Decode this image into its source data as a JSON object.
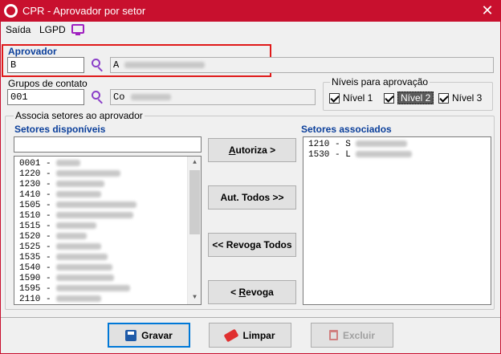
{
  "window": {
    "title": "CPR - Aprovador por setor",
    "close_glyph": "✕"
  },
  "menu": {
    "items": [
      "Saída",
      "LGPD"
    ]
  },
  "aprovador": {
    "label": "Aprovador",
    "code": "B",
    "name": "A"
  },
  "grupos": {
    "label": "Grupos de contato",
    "code": "001",
    "name": "Co"
  },
  "niveis": {
    "legend": "Níveis para aprovação",
    "items": [
      {
        "label": "Nível 1",
        "checked": true
      },
      {
        "label": "Nível 2",
        "checked": true
      },
      {
        "label": "Nível 3",
        "checked": true
      }
    ]
  },
  "associa": {
    "legend": "Associa setores ao aprovador"
  },
  "disponiveis": {
    "label": "Setores disponíveis",
    "filter_value": "",
    "rows": [
      {
        "code": "0001 -",
        "blur_w": 30
      },
      {
        "code": "1220 -",
        "blur_w": 80
      },
      {
        "code": "1230 -",
        "blur_w": 60
      },
      {
        "code": "1410 -",
        "blur_w": 56
      },
      {
        "code": "1505 -",
        "blur_w": 100
      },
      {
        "code": "1510 -",
        "blur_w": 96
      },
      {
        "code": "1515 -",
        "blur_w": 50
      },
      {
        "code": "1520 -",
        "blur_w": 38
      },
      {
        "code": "1525 -",
        "blur_w": 56
      },
      {
        "code": "1535 -",
        "blur_w": 64
      },
      {
        "code": "1540 -",
        "blur_w": 70
      },
      {
        "code": "1590 -",
        "blur_w": 72
      },
      {
        "code": "1595 -",
        "blur_w": 92
      },
      {
        "code": "2110 -",
        "blur_w": 56
      }
    ]
  },
  "associados": {
    "label": "Setores associados",
    "rows": [
      {
        "code": "1210 - S",
        "blur_w": 64
      },
      {
        "code": "1530 - L",
        "blur_w": 70
      }
    ]
  },
  "actions": {
    "autoriza": {
      "prefix": "",
      "underline": "A",
      "rest": "utoriza >"
    },
    "aut_todos": "Aut. Todos >>",
    "revoga_todos": "<< Revoga Todos",
    "revoga": {
      "prefix": "< ",
      "underline": "R",
      "rest": "evoga"
    }
  },
  "footer": {
    "gravar": "Gravar",
    "limpar": "Limpar",
    "excluir": "Excluir"
  },
  "colors": {
    "title_bar": "#c8102e",
    "label_blue": "#0b3f9b",
    "highlight_red": "#e01919",
    "accent": "#8b3fc8"
  }
}
